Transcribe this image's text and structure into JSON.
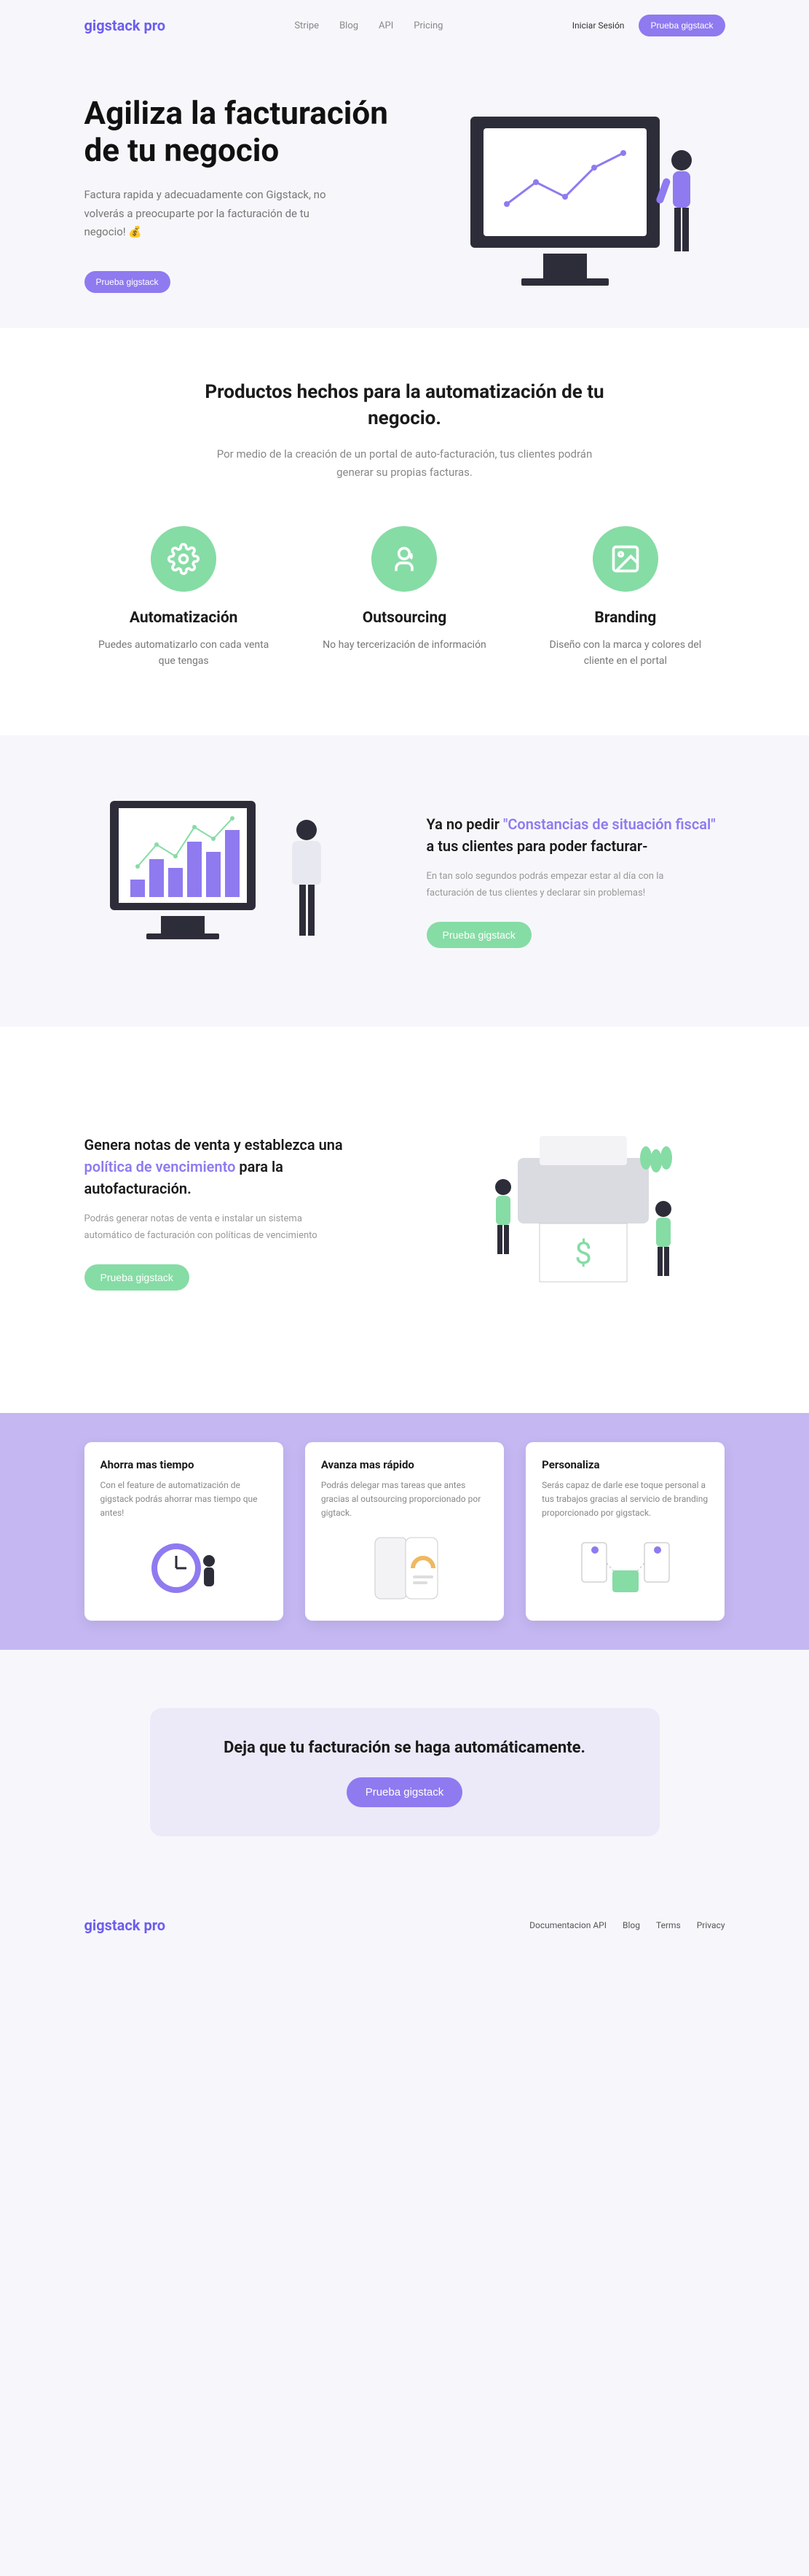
{
  "brand": "gigstack pro",
  "nav": {
    "links": [
      "Stripe",
      "Blog",
      "API",
      "Pricing"
    ],
    "login": "Iniciar Sesión",
    "cta": "Prueba gigstack"
  },
  "hero": {
    "title": "Agiliza la facturación de tu negocio",
    "sub": "Factura rapida y adecuadamente con Gigstack, no volverás a preocuparte por la facturación de tu negocio! 💰",
    "cta": "Prueba gigstack"
  },
  "products": {
    "title": "Productos hechos para la automatización de tu negocio.",
    "sub": "Por medio de la creación de un portal de auto-facturación, tus clientes podrán generar su propias facturas.",
    "items": [
      {
        "title": "Automatización",
        "desc": "Puedes automatizarlo con cada venta que tengas"
      },
      {
        "title": "Outsourcing",
        "desc": "No hay tercerización de información"
      },
      {
        "title": "Branding",
        "desc": "Diseño con la marca y colores del cliente en el portal"
      }
    ]
  },
  "section1": {
    "pre": "Ya no pedir ",
    "highlight": "\"Constancias de situación fiscal\"",
    "post": " a tus clientes para poder facturar-",
    "desc": "En tan solo segundos podrás empezar estar al día con la facturación de tus clientes y declarar sin problemas!",
    "cta": "Prueba gigstack"
  },
  "section2": {
    "pre": "Genera notas de venta y establezca una ",
    "highlight": "política de vencimiento",
    "post": " para la autofacturación.",
    "desc": "Podrás generar notas de venta e instalar un sistema automático de facturación con políticas de vencimiento",
    "cta": "Prueba gigstack"
  },
  "cards": [
    {
      "title": "Ahorra mas tiempo",
      "desc": "Con el feature de automatización de gigstack podrás ahorrar mas tiempo que antes!"
    },
    {
      "title": "Avanza mas rápido",
      "desc": "Podrás delegar mas tareas que antes gracias al outsourcing proporcionado por gigtack."
    },
    {
      "title": "Personaliza",
      "desc": "Serás capaz de darle ese toque personal a tus trabajos gracias al servicio de branding proporcionado por gigstack."
    }
  ],
  "cta": {
    "title": "Deja que tu facturación se haga automáticamente.",
    "button": "Prueba gigstack"
  },
  "footer": {
    "links": [
      "Documentacion API",
      "Blog",
      "Terms",
      "Privacy"
    ]
  }
}
